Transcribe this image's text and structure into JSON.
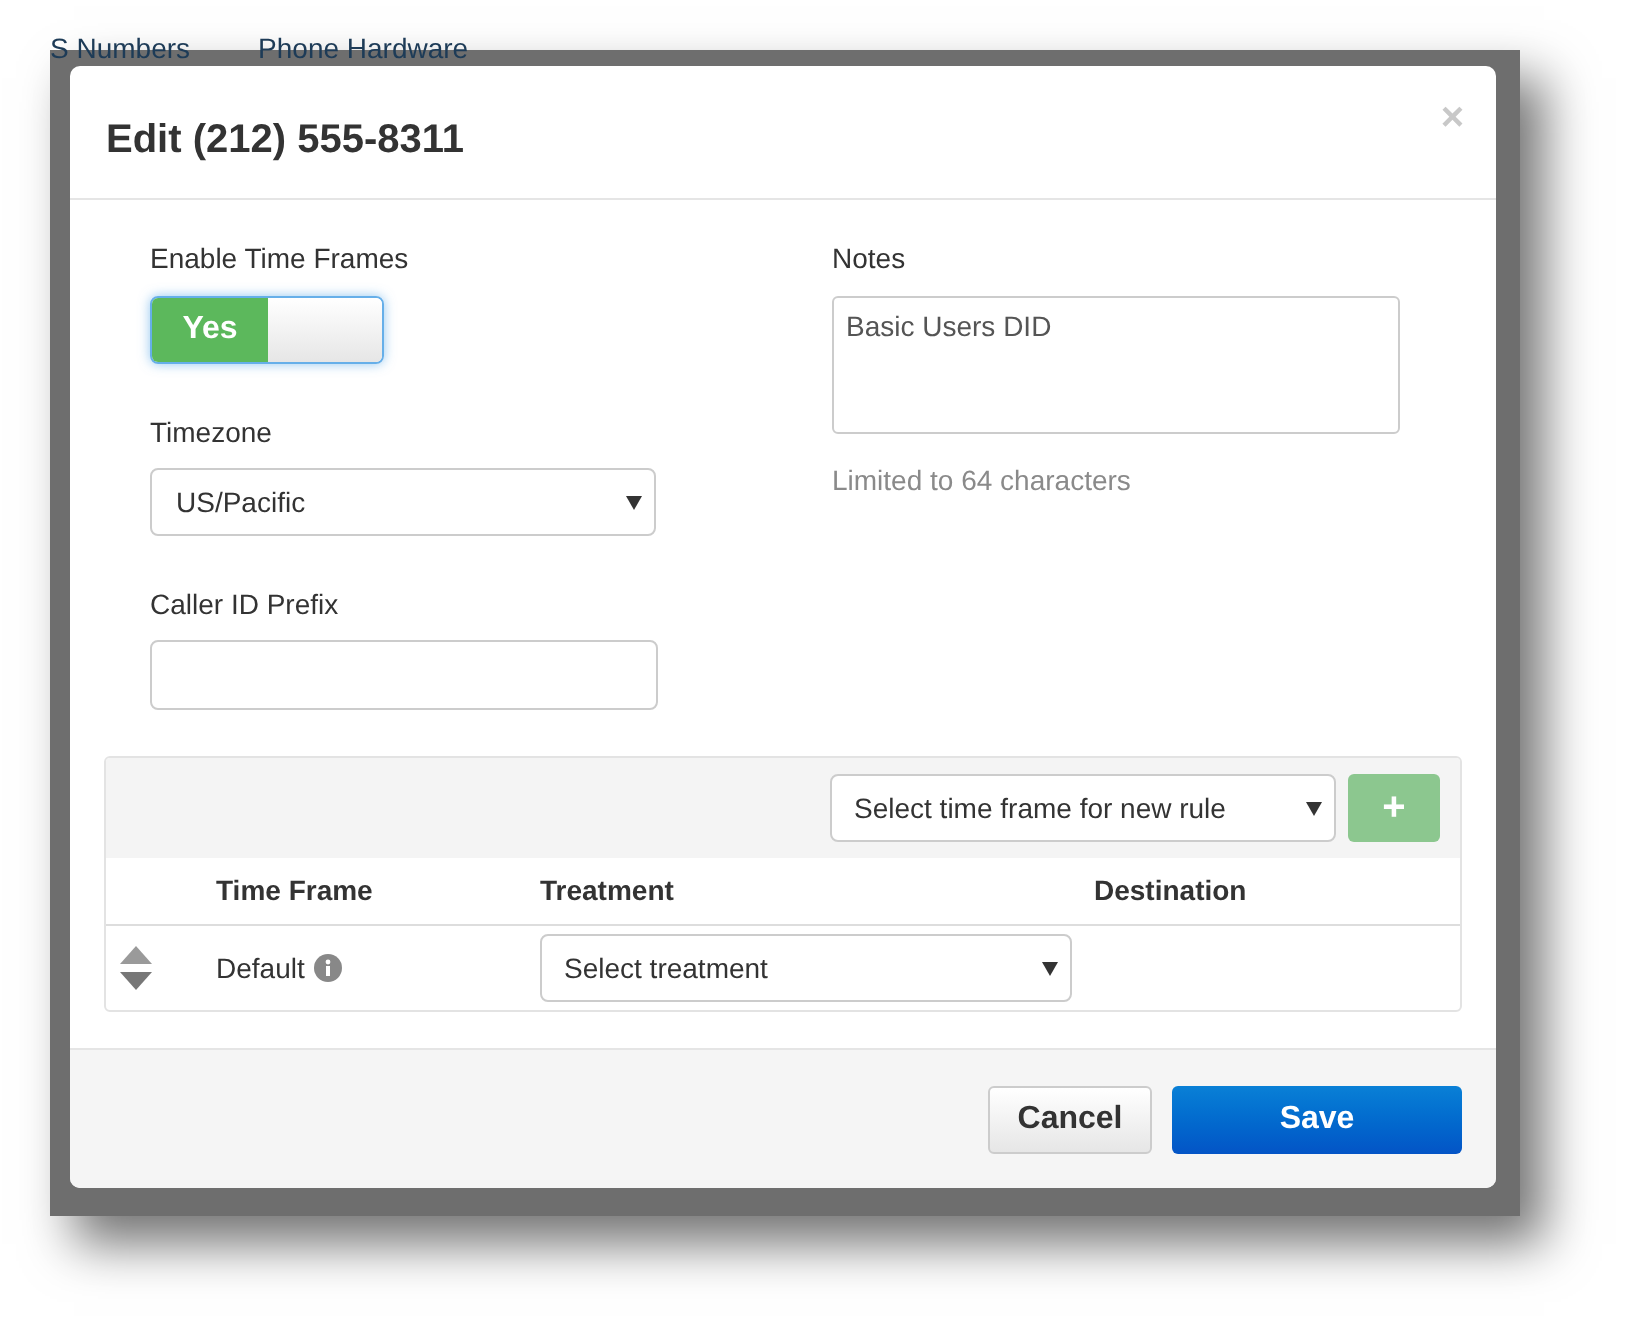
{
  "background_tabs": [
    "S Numbers",
    "Phone Hardware"
  ],
  "modal": {
    "title": "Edit (212) 555-8311",
    "close": "×",
    "enable_time_frames": {
      "label": "Enable Time Frames",
      "on": true,
      "on_text": "Yes"
    },
    "timezone": {
      "label": "Timezone",
      "value": "US/Pacific"
    },
    "caller_id_prefix": {
      "label": "Caller ID Prefix"
    },
    "notes": {
      "label": "Notes",
      "value": "Basic Users DID",
      "help": "Limited to 64 characters"
    },
    "rules": {
      "new_rule_select": "Select time frame for new rule",
      "add_button": "+",
      "columns": [
        "Time Frame",
        "Treatment",
        "Destination"
      ],
      "rows": [
        {
          "time_frame": "Default",
          "treatment": "Select treatment"
        }
      ]
    },
    "buttons": [
      "Cancel",
      "Save"
    ]
  }
}
